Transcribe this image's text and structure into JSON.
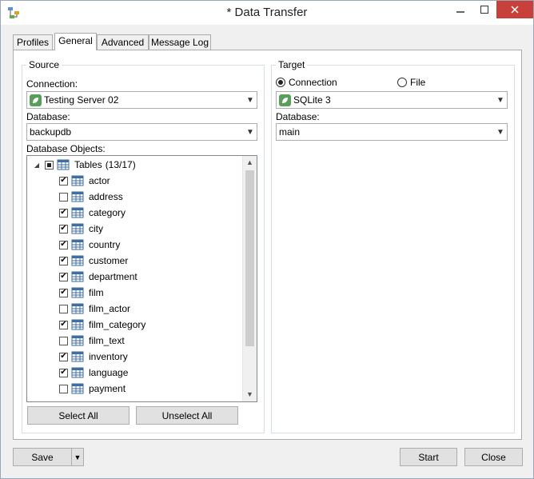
{
  "window": {
    "title": "* Data Transfer"
  },
  "tabs": [
    {
      "label": "Profiles"
    },
    {
      "label": "General"
    },
    {
      "label": "Advanced"
    },
    {
      "label": "Message Log"
    }
  ],
  "source": {
    "legend": "Source",
    "connection_label": "Connection:",
    "connection_value": "Testing Server 02",
    "database_label": "Database:",
    "database_value": "backupdb",
    "objects_label": "Database Objects:",
    "tree": {
      "root": {
        "label": "Tables",
        "count": "(13/17)",
        "state": "partial"
      },
      "items": [
        {
          "label": "actor",
          "checked": true
        },
        {
          "label": "address",
          "checked": false
        },
        {
          "label": "category",
          "checked": true
        },
        {
          "label": "city",
          "checked": true
        },
        {
          "label": "country",
          "checked": true
        },
        {
          "label": "customer",
          "checked": true
        },
        {
          "label": "department",
          "checked": true
        },
        {
          "label": "film",
          "checked": true
        },
        {
          "label": "film_actor",
          "checked": false
        },
        {
          "label": "film_category",
          "checked": true
        },
        {
          "label": "film_text",
          "checked": false
        },
        {
          "label": "inventory",
          "checked": true
        },
        {
          "label": "language",
          "checked": true
        },
        {
          "label": "payment",
          "checked": false
        }
      ]
    },
    "select_all": "Select All",
    "unselect_all": "Unselect All"
  },
  "target": {
    "legend": "Target",
    "radio_connection": "Connection",
    "radio_file": "File",
    "selected": "connection",
    "connection_value": "SQLite 3",
    "database_label": "Database:",
    "database_value": "main"
  },
  "footer": {
    "save": "Save",
    "start": "Start",
    "close": "Close"
  },
  "colors": {
    "connection_icon": "#5a9e5c",
    "close_button": "#c7403a",
    "table_icon": "#3c6ea5"
  }
}
